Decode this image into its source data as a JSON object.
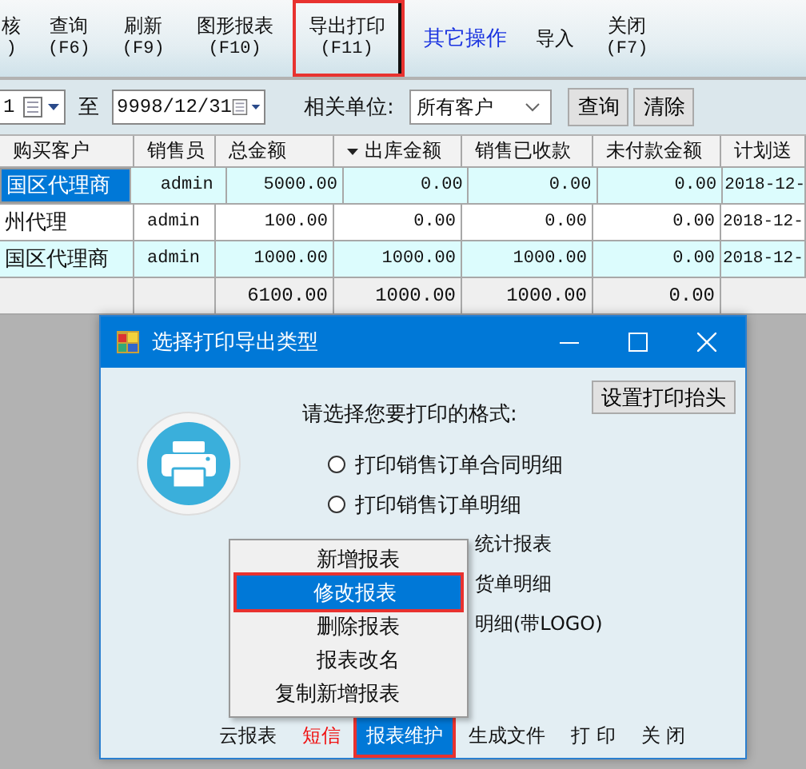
{
  "toolbar": {
    "items": [
      {
        "label": "核",
        "key": ")",
        "kind": "button",
        "highlighted": false
      },
      {
        "label": "查询",
        "key": "(F6)",
        "kind": "button",
        "highlighted": false
      },
      {
        "label": "刷新",
        "key": "(F9)",
        "kind": "button",
        "highlighted": false
      },
      {
        "label": "图形报表",
        "key": "(F10)",
        "kind": "button",
        "highlighted": false
      },
      {
        "label": "导出打印",
        "key": "(F11)",
        "kind": "button",
        "highlighted": true
      },
      {
        "label": "其它操作",
        "kind": "link",
        "highlighted": false
      },
      {
        "label": "导入",
        "kind": "button",
        "highlighted": false
      },
      {
        "label": "关闭",
        "key": "(F7)",
        "kind": "button",
        "highlighted": false
      }
    ]
  },
  "filter": {
    "date_from": "1",
    "to_label": "至",
    "date_to": "9998/12/31",
    "unit_label": "相关单位:",
    "unit_value": "所有客户",
    "buttons": [
      "查询",
      "清除"
    ]
  },
  "table": {
    "columns": [
      "购买客户",
      "销售员",
      "总金额",
      "出库金额",
      "销售已收款",
      "未付款金额",
      "计划送"
    ],
    "rows": [
      {
        "cells": [
          "国区代理商",
          "admin",
          "5000.00",
          "0.00",
          "0.00",
          "0.00",
          "2018-12-"
        ],
        "selected": true
      },
      {
        "cells": [
          "州代理",
          "admin",
          "100.00",
          "0.00",
          "0.00",
          "0.00",
          "2018-12-"
        ],
        "selected": false
      },
      {
        "cells": [
          "国区代理商",
          "admin",
          "1000.00",
          "1000.00",
          "1000.00",
          "0.00",
          "2018-12-"
        ],
        "selected": false
      }
    ],
    "totals": [
      "6100.00",
      "1000.00",
      "1000.00",
      "0.00"
    ]
  },
  "dialog": {
    "title": "选择打印导出类型",
    "header_button": "设置打印抬头",
    "prompt": "请选择您要打印的格式:",
    "options": [
      {
        "label": "打印销售订单合同明细",
        "kind": "radio",
        "selected": false
      },
      {
        "label": "打印销售订单明细",
        "kind": "radio",
        "selected": false
      },
      {
        "label": "统计报表",
        "kind": "covered"
      },
      {
        "label": "货单明细",
        "kind": "covered"
      },
      {
        "label": "明细(带LOGO)",
        "kind": "covered"
      }
    ],
    "buttons": [
      {
        "label": "云报表",
        "kind": "plain",
        "selected": false
      },
      {
        "label": "短信",
        "kind": "alert",
        "selected": false
      },
      {
        "label": "报表维护",
        "kind": "plain",
        "selected": true
      },
      {
        "label": "生成文件",
        "kind": "plain",
        "selected": false
      },
      {
        "label": "打 印",
        "kind": "plain",
        "selected": false
      },
      {
        "label": "关 闭",
        "kind": "plain",
        "selected": false
      }
    ]
  },
  "menu": {
    "items": [
      {
        "label": "新增报表",
        "selected": false
      },
      {
        "label": "修改报表",
        "selected": true
      },
      {
        "label": "删除报表",
        "selected": false
      },
      {
        "label": "报表改名",
        "selected": false
      },
      {
        "label": "复制新增报表",
        "selected": false
      }
    ]
  }
}
